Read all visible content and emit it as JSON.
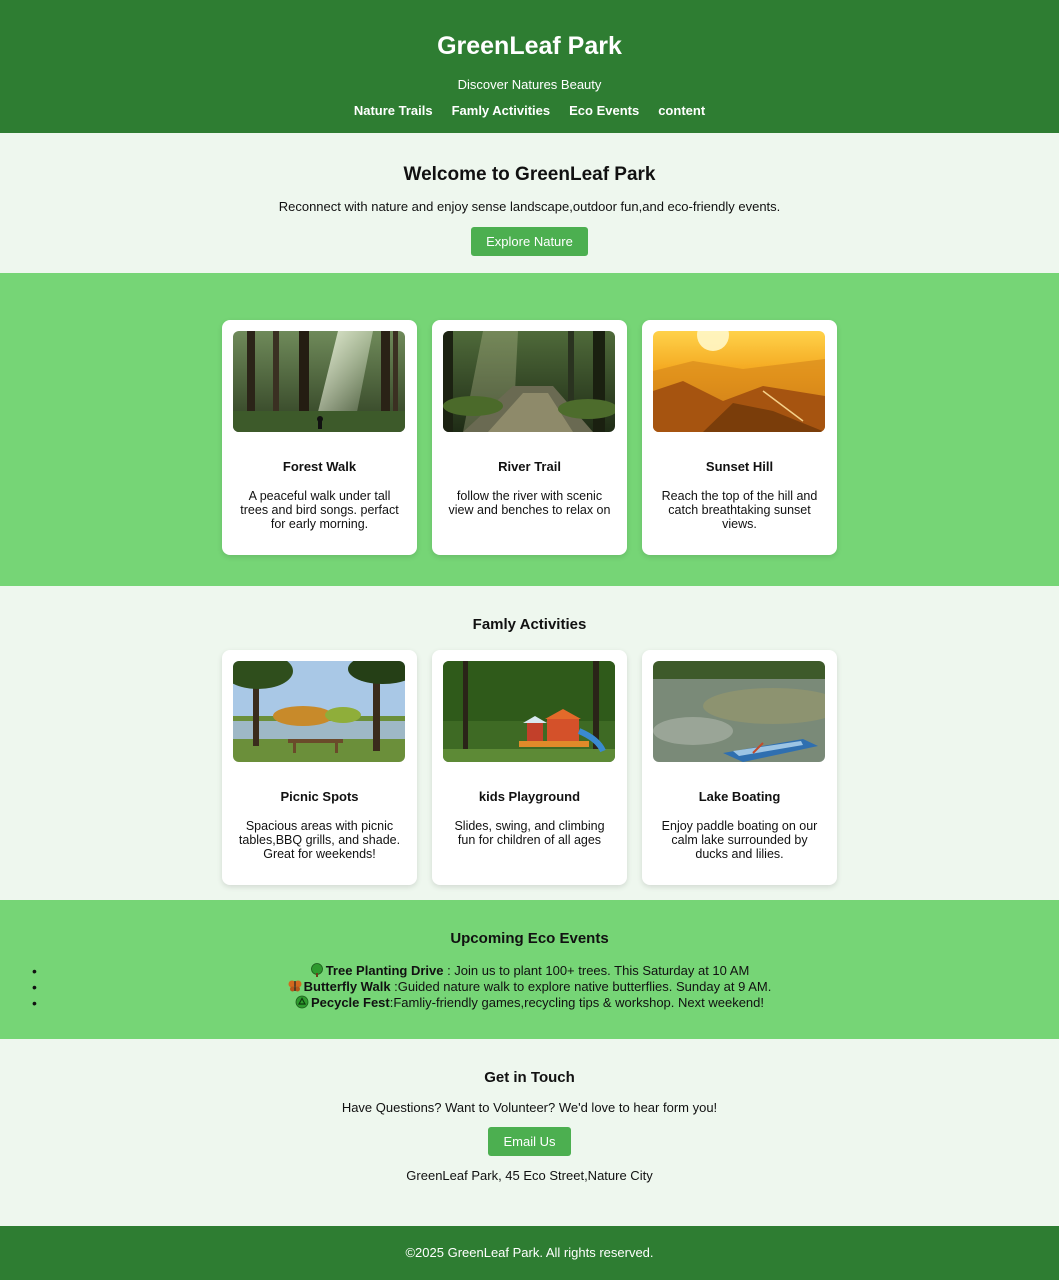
{
  "header": {
    "title": "GreenLeaf Park",
    "tagline": "Discover Natures Beauty",
    "nav": [
      "Nature Trails",
      "Famly Activities",
      "Eco Events",
      "content"
    ]
  },
  "hero": {
    "title": "Welcome to GreenLeaf Park",
    "text": "Reconnect with nature and enjoy sense landscape,outdoor fun,and eco-friendly events.",
    "button": "Explore Nature"
  },
  "trails": {
    "cards": [
      {
        "title": "Forest Walk",
        "text": "A peaceful walk under tall trees and bird songs. perfact for early morning.",
        "image": "forest-photo"
      },
      {
        "title": "River Trail",
        "text": "follow the river with scenic view and benches to relax on",
        "image": "river-photo"
      },
      {
        "title": "Sunset Hill",
        "text": "Reach the top of the hill and catch breathtaking sunset views.",
        "image": "sunset-photo"
      }
    ]
  },
  "family": {
    "title": "Famly Activities",
    "cards": [
      {
        "title": "Picnic Spots",
        "text": "Spacious areas with picnic tables,BBQ grills, and shade. Great for weekends!",
        "image": "picnic-photo"
      },
      {
        "title": "kids Playground",
        "text": "Slides, swing, and climbing fun for children of all ages",
        "image": "playground-photo"
      },
      {
        "title": "Lake Boating",
        "text": "Enjoy paddle boating on our calm lake surrounded by ducks and lilies.",
        "image": "boat-photo"
      }
    ]
  },
  "events": {
    "title": "Upcoming Eco Events",
    "items": [
      {
        "icon": "tree-icon",
        "name": "Tree Planting Drive",
        "text": " : Join us to plant 100+ trees. This Saturday at 10 AM"
      },
      {
        "icon": "butterfly-icon",
        "name": "Butterfly Walk",
        "text": " :Guided nature walk to explore native butterflies. Sunday at 9 AM."
      },
      {
        "icon": "recycle-icon",
        "name": "Pecycle Fest",
        "text": ":Famliy-friendly games,recycling tips & workshop. Next weekend!"
      }
    ]
  },
  "contact": {
    "title": "Get in Touch",
    "text": "Have Questions? Want to Volunteer? We'd love to hear form you!",
    "button": "Email Us",
    "address": "GreenLeaf Park, 45 Eco Street,Nature City"
  },
  "footer": {
    "text": "©2025 GreenLeaf Park. All rights reserved."
  },
  "colors": {
    "header": "#2e7d32",
    "band": "#76d576",
    "light": "#eef7ee",
    "button": "#4caf50"
  }
}
